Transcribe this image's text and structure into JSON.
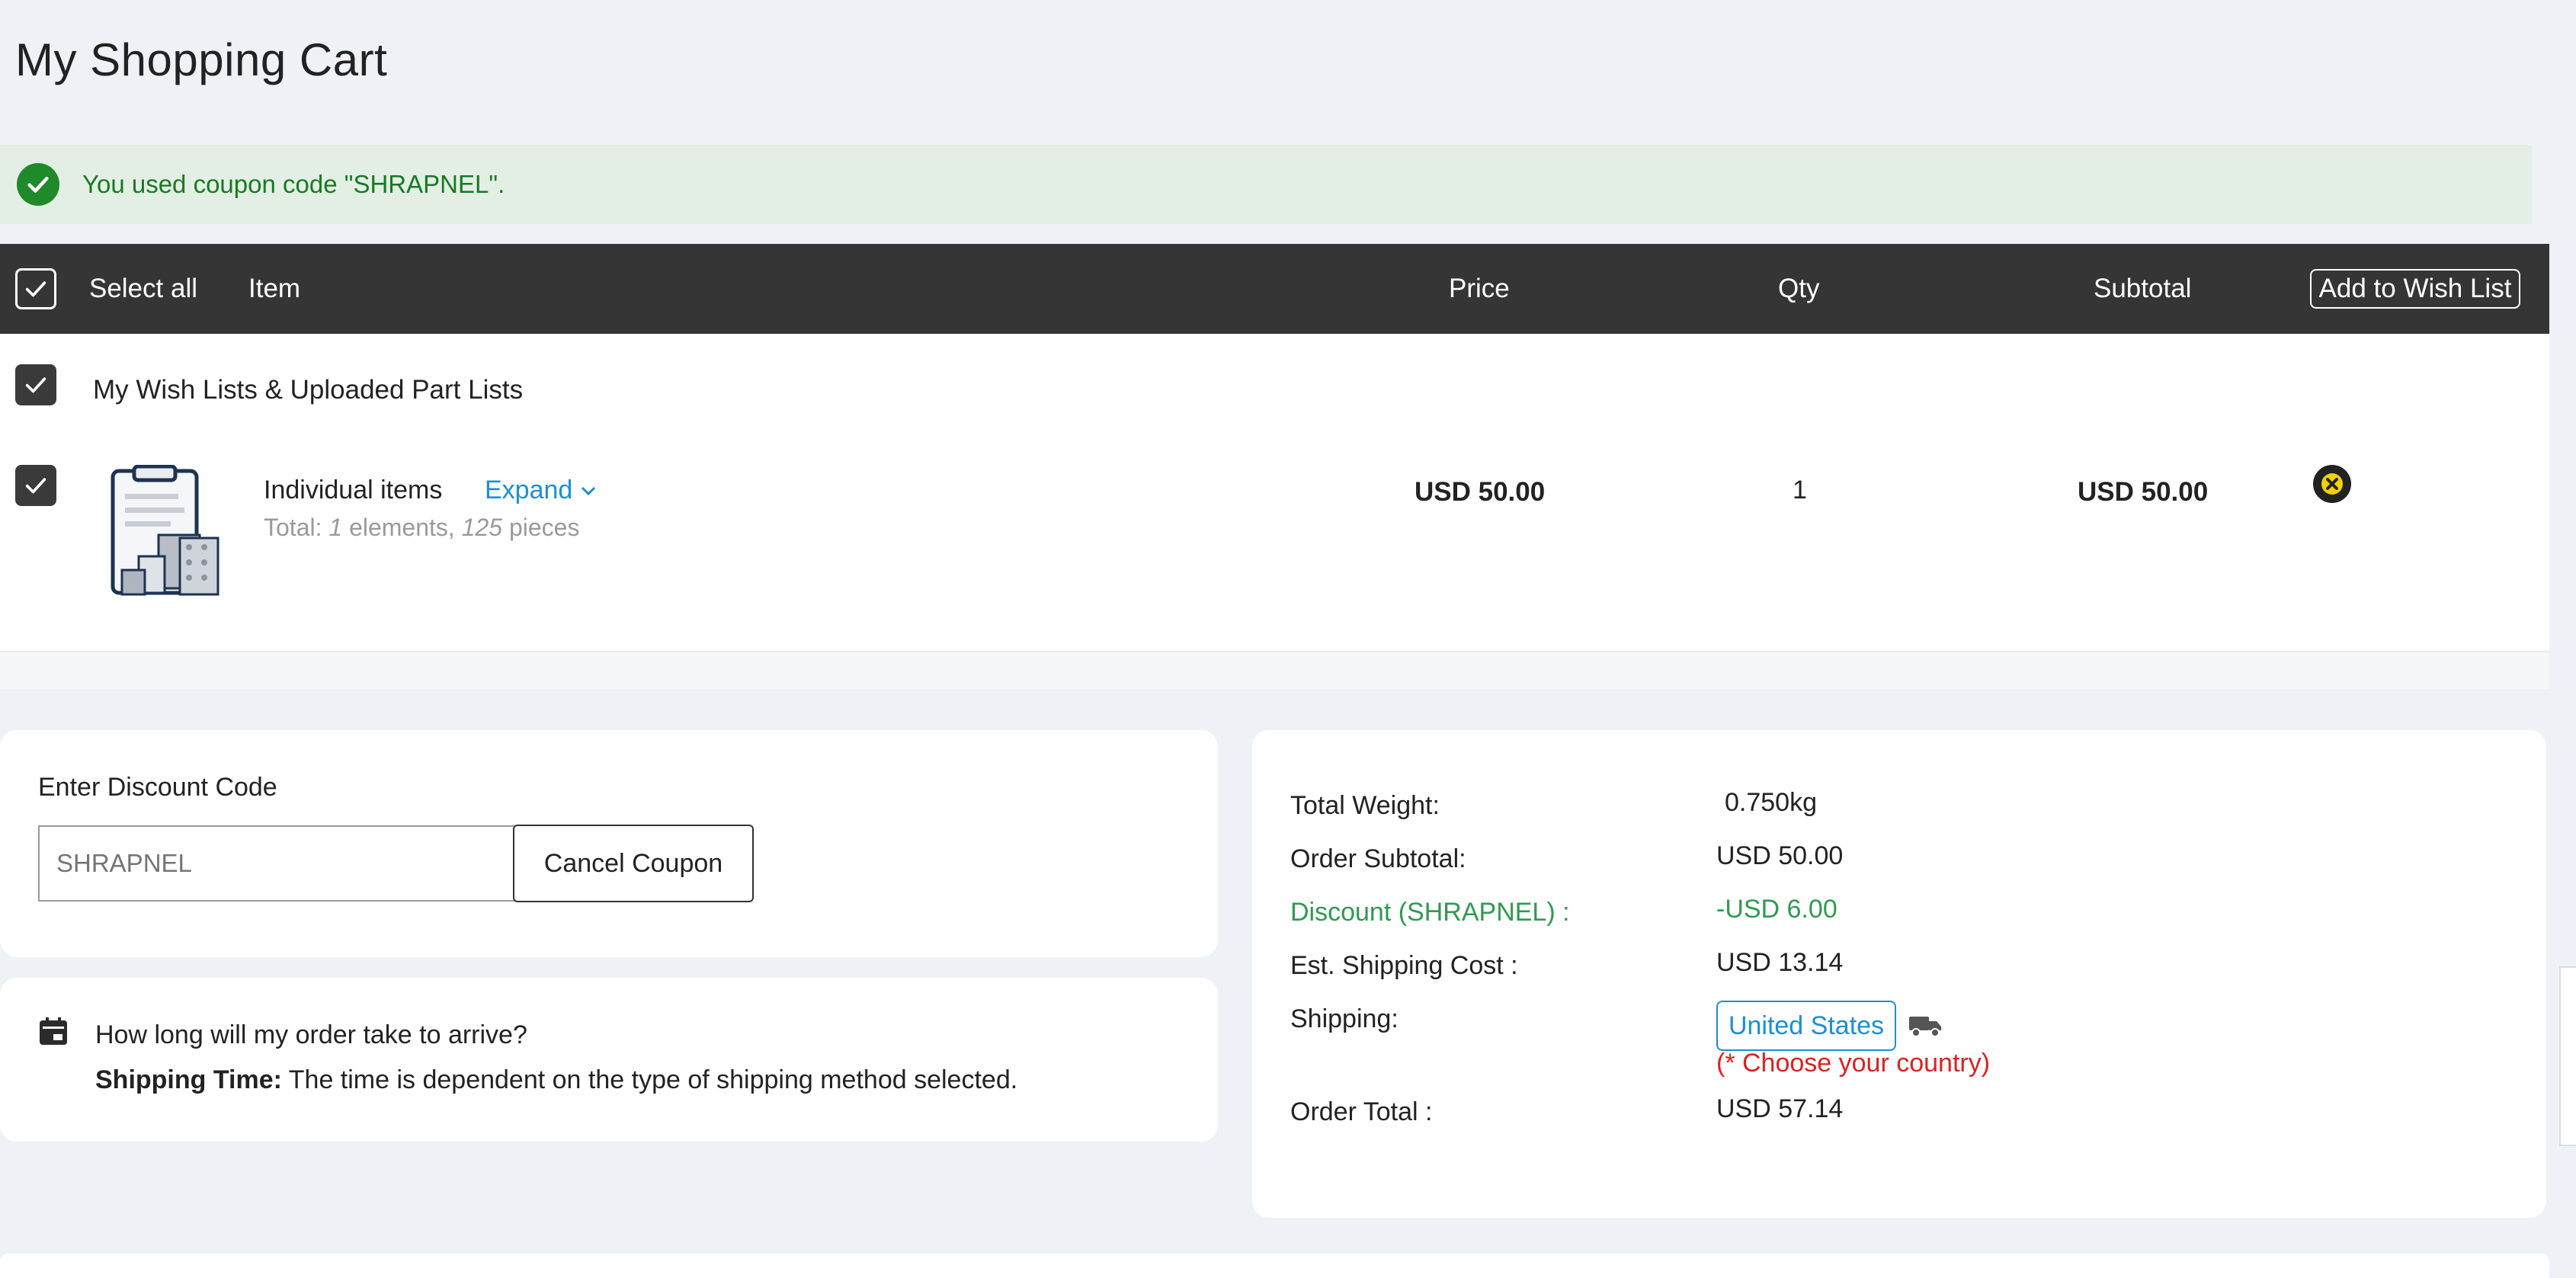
{
  "page": {
    "title": "My Shopping Cart"
  },
  "alert": {
    "message": "You used coupon code \"SHRAPNEL\"."
  },
  "table_header": {
    "select_all": "Select all",
    "item": "Item",
    "price": "Price",
    "qty": "Qty",
    "subtotal": "Subtotal",
    "add_to_wishlist": "Add to Wish List"
  },
  "cart": {
    "group_label": "My Wish Lists & Uploaded Part Lists",
    "items": [
      {
        "name": "Individual items",
        "expand_label": "Expand",
        "total_prefix": "Total: ",
        "elements_count": "1",
        "elements_label": " elements, ",
        "pieces_count": "125",
        "pieces_label": " pieces",
        "price": "USD 50.00",
        "qty": "1",
        "subtotal": "USD 50.00"
      }
    ]
  },
  "discount": {
    "title": "Enter Discount Code",
    "placeholder": "SHRAPNEL",
    "cancel_label": "Cancel Coupon"
  },
  "shipping_info": {
    "question": "How long will my order take to arrive?",
    "answer_label": "Shipping Time:",
    "answer_text": " The time is dependent on the type of shipping method selected."
  },
  "summary": {
    "total_weight_label": "Total Weight:",
    "total_weight_value": "0.750kg",
    "order_subtotal_label": "Order Subtotal:",
    "order_subtotal_value": "USD 50.00",
    "discount_label": "Discount (SHRAPNEL) :",
    "discount_value": "-USD 6.00",
    "est_shipping_label": "Est. Shipping Cost :",
    "est_shipping_value": "USD 13.14",
    "shipping_label": "Shipping:",
    "country": "United States",
    "choose_country_note": "(* Choose your country)",
    "order_total_label": "Order Total :",
    "order_total_value": "USD 57.14"
  },
  "colors": {
    "accent_blue": "#1b8fd6",
    "success_green": "#177a24",
    "discount_green": "#2f9a52",
    "warning_red": "#e02020",
    "header_dark": "#353535"
  }
}
